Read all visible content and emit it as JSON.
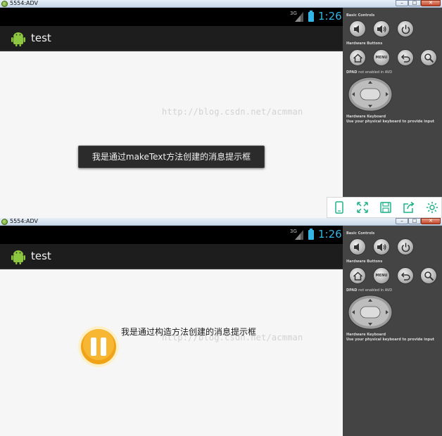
{
  "windows": [
    {
      "window_title": "5554:ADV",
      "app_title": "test",
      "status": {
        "network": "3G",
        "clock": "1:26"
      },
      "watermark": "http://blog.csdn.net/acmman",
      "message": "我是通过makeText方法创建的消息提示框"
    },
    {
      "window_title": "5554:ADV",
      "app_title": "test",
      "status": {
        "network": "3G",
        "clock": "1:26"
      },
      "watermark": "http://blog.csdn.net/acmman",
      "message": "我是通过构造方法创建的消息提示框"
    }
  ],
  "panel": {
    "basic_controls": "Basic Controls",
    "hardware_buttons": "Hardware Buttons",
    "menu_label": "MENU",
    "dpad_label": "DPAD",
    "dpad_note": "not enabled in AVD",
    "hardware_keyboard": "Hardware Keyboard",
    "keyboard_note": "Use your physical keyboard to provide input"
  },
  "colors": {
    "accent": "#33b5e5",
    "tool_green": "#1fb38a",
    "pause_orange": "#f5a623"
  },
  "icons": [
    "volume-down-icon",
    "volume-up-icon",
    "power-icon",
    "home-icon",
    "back-icon",
    "search-icon",
    "phone-icon",
    "fullscreen-icon",
    "save-icon",
    "share-icon",
    "settings-icon"
  ]
}
